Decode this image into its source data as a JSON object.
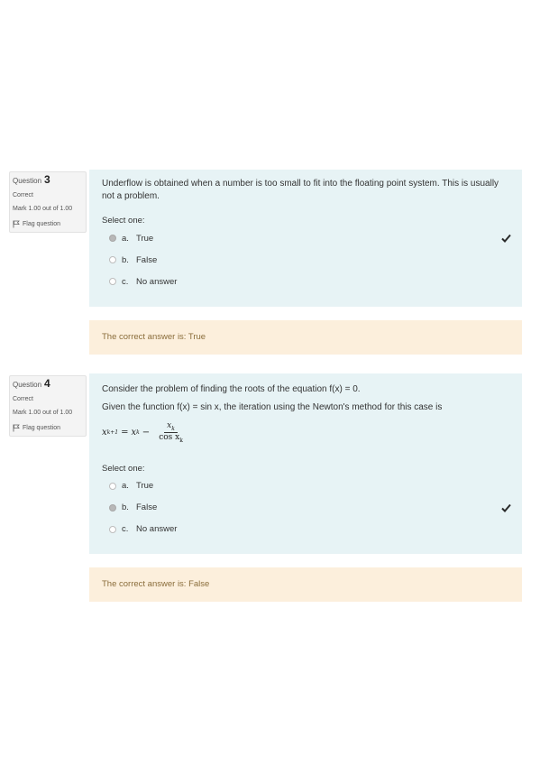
{
  "questions": [
    {
      "label": "Question",
      "number": "3",
      "state": "Correct",
      "mark": "Mark 1.00 out of 1.00",
      "flag": "Flag question",
      "text": "Underflow is obtained when a number is too small to fit into the floating point system. This is usually not a problem.",
      "select_one": "Select one:",
      "options": [
        {
          "letter": "a.",
          "label": "True",
          "selected": true,
          "correct": true
        },
        {
          "letter": "b.",
          "label": "False",
          "selected": false,
          "correct": false
        },
        {
          "letter": "c.",
          "label": "No answer",
          "selected": false,
          "correct": false
        }
      ],
      "feedback": "The correct answer is: True"
    },
    {
      "label": "Question",
      "number": "4",
      "state": "Correct",
      "mark": "Mark 1.00 out of 1.00",
      "flag": "Flag question",
      "text": "Consider the problem of finding the roots of the equation f(x) = 0.",
      "text2": "Given the function f(x) = sin x, the iteration using the Newton's method for this case is",
      "formula": {
        "lhs": "x",
        "lhs_sub": "k+1",
        "rhs_var": "x",
        "rhs_sub": "k",
        "numerator": "x",
        "numerator_sub": "k",
        "denominator": "cos x",
        "denominator_sub": "k"
      },
      "select_one": "Select one:",
      "options": [
        {
          "letter": "a.",
          "label": "True",
          "selected": false,
          "correct": false
        },
        {
          "letter": "b.",
          "label": "False",
          "selected": true,
          "correct": true
        },
        {
          "letter": "c.",
          "label": "No answer",
          "selected": false,
          "correct": false
        }
      ],
      "feedback": "The correct answer is: False"
    }
  ],
  "colors": {
    "content_bg": "#e7f3f5",
    "feedback_bg": "#fcefdc",
    "feedback_text": "#8a6d3b",
    "check": "#2b2b2b"
  },
  "icons": {
    "flag": "flag-icon",
    "check": "check-icon",
    "radio": "radio-icon"
  }
}
